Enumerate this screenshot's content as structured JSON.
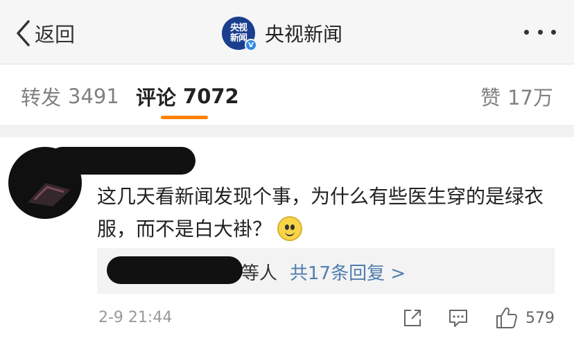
{
  "navbar": {
    "back_label": "返回",
    "channel_name": "央视新闻",
    "logo_text": "央视新闻",
    "verified_badge": "V",
    "icons": {
      "back": "chevron-left-icon",
      "more": "more-dots-icon"
    }
  },
  "tabs": {
    "repost": {
      "label": "转发",
      "count": "3491"
    },
    "comment": {
      "label": "评论",
      "count": "7072"
    },
    "likes": {
      "label": "赞",
      "count": "17万"
    },
    "accent_color": "#ff8200"
  },
  "comment": {
    "text": "这几天看新闻发现个事，为什么有些医生穿的是绿衣服，而不是白大褂？",
    "emoji": "smile-emoji",
    "replies": {
      "suffix": "等人",
      "link": "共17条回复 >"
    },
    "timestamp": "2-9 21:44",
    "like_count": "579",
    "icons": [
      "share-icon",
      "comment-icon",
      "thumbs-up-icon"
    ]
  },
  "colors": {
    "link": "#507daf",
    "secondary_text": "#999999",
    "verified": "#2f8ae5"
  }
}
